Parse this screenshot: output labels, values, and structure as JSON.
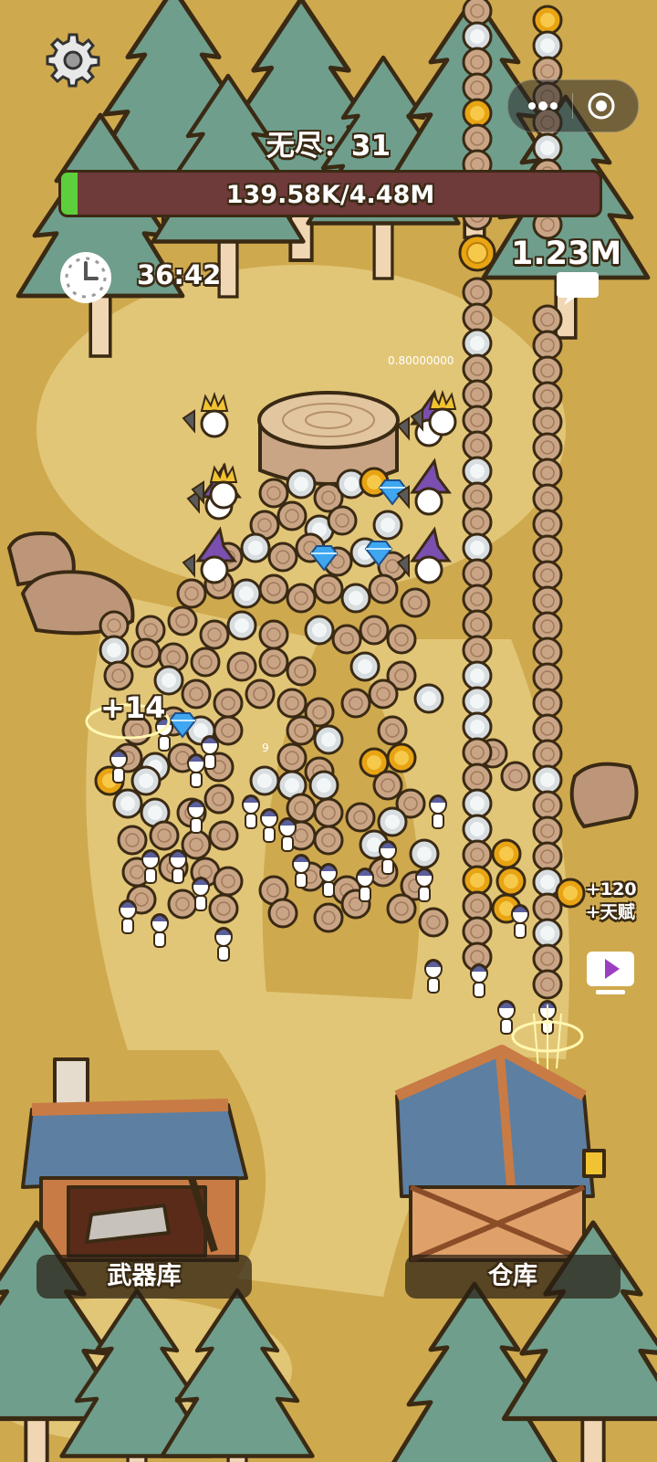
{
  "hud": {
    "level_text": "无尽：31",
    "hp_text": "139.58K/4.48M",
    "hp_fraction": 0.031,
    "timer": "36:42",
    "coins": "1.23M"
  },
  "floating": {
    "plus_bonus": "+14",
    "reward_line1": "+120",
    "reward_line2": "+天赋",
    "small_number": "9",
    "damage_text": "0.80000000"
  },
  "buildings": {
    "armory_label": "武器库",
    "warehouse_label": "仓库"
  },
  "icons": {
    "settings": "gear-icon",
    "more": "more-dots-icon",
    "close": "target-close-icon",
    "timer": "clock-icon",
    "currency": "coin-icon",
    "chat": "chat-bubble-icon",
    "video_ad": "play-video-icon"
  },
  "colors": {
    "ground": "#cfa94e",
    "path": "#e2c677",
    "tree": "#6f9e8c",
    "hp_bar_bg": "#6e3a3a",
    "hp_fill": "#5ecf3c",
    "coin": "#e8a413",
    "gem": "#3fa6f0"
  }
}
